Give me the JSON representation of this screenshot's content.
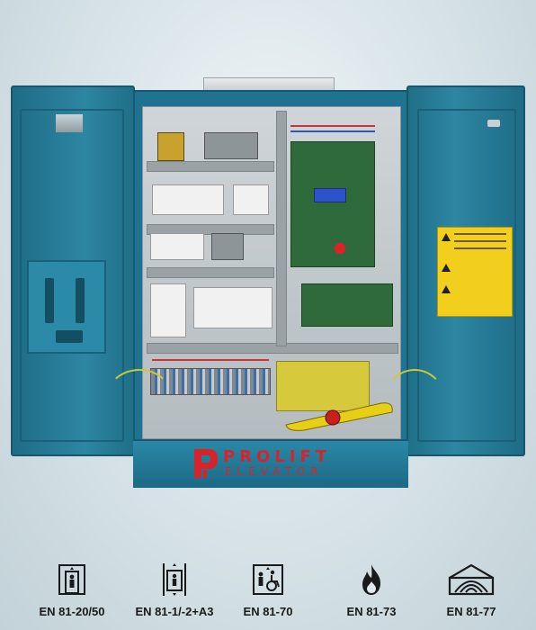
{
  "brand": {
    "name": "PROLIFT",
    "subtitle": "ELEVATOR"
  },
  "standards": [
    {
      "label": "EN 81-20/50",
      "icon": "elevator-car-icon"
    },
    {
      "label": "EN 81-1/-2+A3",
      "icon": "elevator-shaft-icon"
    },
    {
      "label": "EN 81-70",
      "icon": "accessibility-elevator-icon"
    },
    {
      "label": "EN 81-73",
      "icon": "fire-icon"
    },
    {
      "label": "EN 81-77",
      "icon": "earthquake-icon"
    }
  ],
  "colors": {
    "cabinet": "#1f7391",
    "brand": "#d8232a",
    "warning_label": "#f2cf1d"
  }
}
